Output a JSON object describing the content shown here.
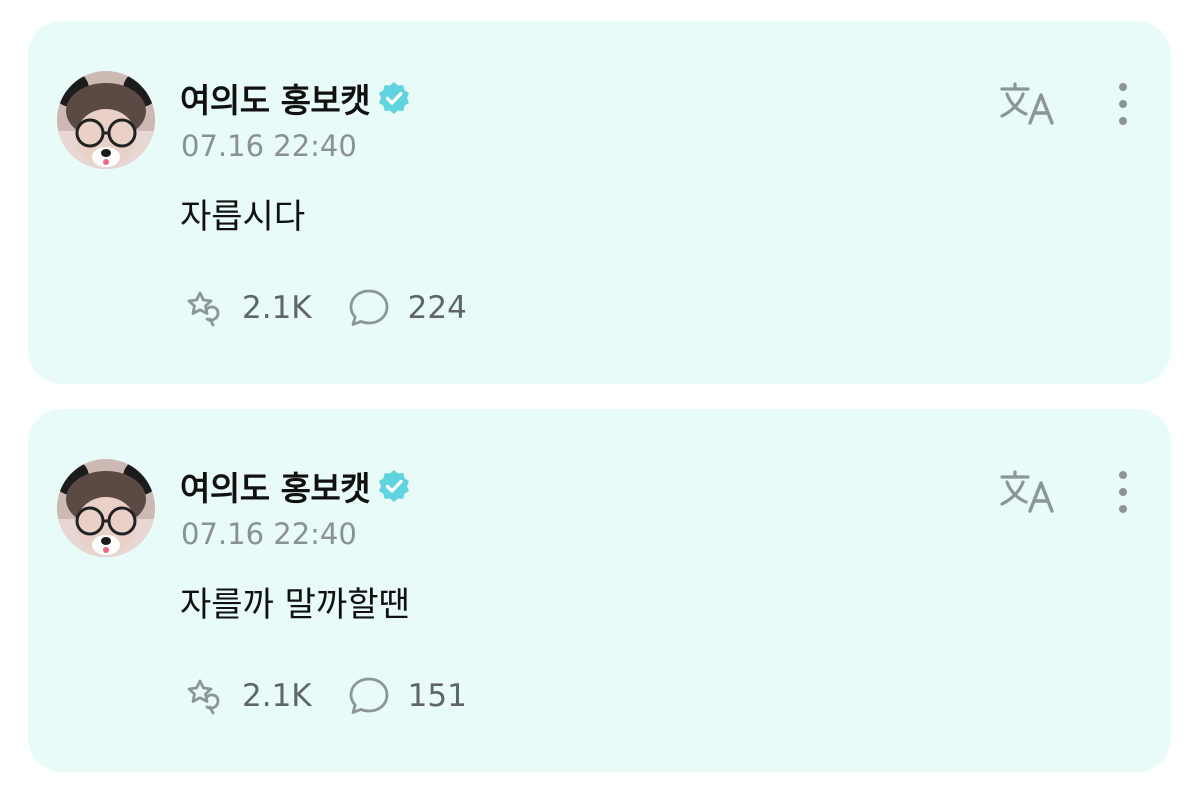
{
  "posts": [
    {
      "author_name": "여의도 홍보캣",
      "timestamp": "07.16 22:40",
      "text": "자릅시다",
      "reaction_count": "2.1K",
      "comment_count": "224"
    },
    {
      "author_name": "여의도 홍보캣",
      "timestamp": "07.16 22:40",
      "text": "자를까 말까할땐",
      "reaction_count": "2.1K",
      "comment_count": "151"
    }
  ],
  "icons": {
    "verified": "verified-badge-icon",
    "translate": "translate-icon",
    "more": "more-vertical-icon",
    "reaction": "reaction-icon",
    "comment": "comment-bubble-icon"
  },
  "colors": {
    "card_background": "#e9fbf8",
    "verified_badge": "#5fd3e0",
    "icon_gray": "#8c9598",
    "text_primary": "#111111",
    "text_secondary": "#8a9194"
  }
}
